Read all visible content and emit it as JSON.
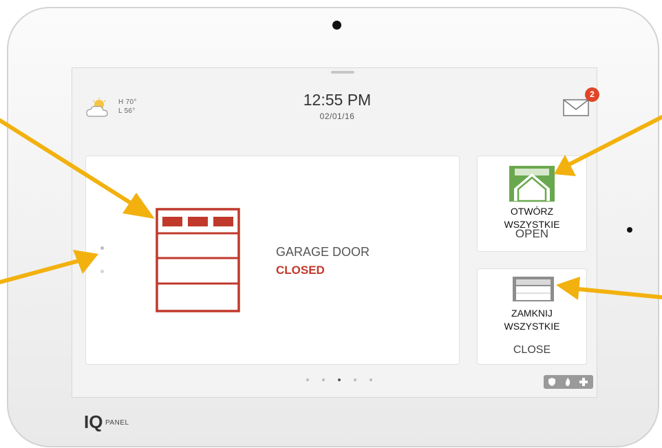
{
  "weather": {
    "high": "H 70°",
    "low": "L 56°"
  },
  "clock": {
    "time": "12:55 PM",
    "date": "02/01/16"
  },
  "messages": {
    "unread_count": "2"
  },
  "device": {
    "name": "GARAGE DOOR",
    "status": "CLOSED"
  },
  "open_all": {
    "label": "OPEN",
    "annotation_line1": "OTWÓRZ",
    "annotation_line2": "WSZYSTKIE"
  },
  "close_all": {
    "label": "CLOSE",
    "annotation_line1": "ZAMKNIJ",
    "annotation_line2": "WSZYSTKIE"
  },
  "pagination": {
    "pages": 5,
    "current_page": 3
  },
  "brand": {
    "logo": "IQ",
    "sub": "PANEL"
  },
  "colors": {
    "accent_red": "#c0392b",
    "open_green": "#6aa84f",
    "arrow_orange": "#f2b10e",
    "badge_red": "#e0452a"
  }
}
